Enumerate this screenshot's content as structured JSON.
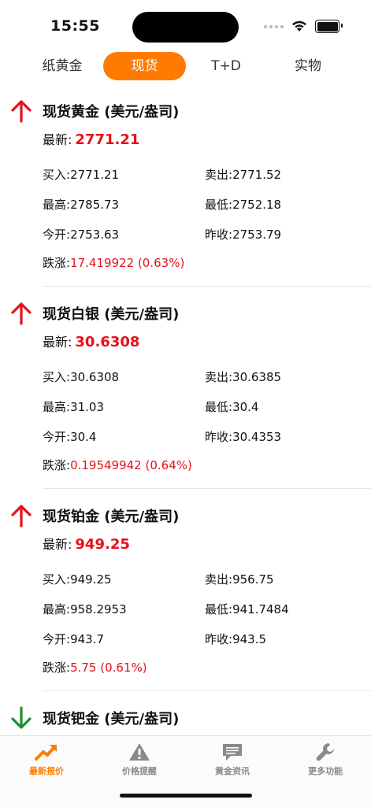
{
  "status": {
    "time": "15:55"
  },
  "tabs": [
    {
      "label": "纸黄金"
    },
    {
      "label": "现货"
    },
    {
      "label": "T+D"
    },
    {
      "label": "实物"
    }
  ],
  "items": [
    {
      "direction": "up",
      "title": "现货黄金 (美元/盎司)",
      "latest_label": "最新:",
      "latest": "2771.21",
      "buy_label": "买入:",
      "buy": "2771.21",
      "sell_label": "卖出:",
      "sell": "2771.52",
      "high_label": "最高:",
      "high": "2785.73",
      "low_label": "最低:",
      "low": "2752.18",
      "open_label": "今开:",
      "open": "2753.63",
      "close_label": "昨收:",
      "close": "2753.79",
      "change_label": "跌涨:",
      "change": "17.419922 (0.63%)"
    },
    {
      "direction": "up",
      "title": "现货白银 (美元/盎司)",
      "latest_label": "最新:",
      "latest": "30.6308",
      "buy_label": "买入:",
      "buy": "30.6308",
      "sell_label": "卖出:",
      "sell": "30.6385",
      "high_label": "最高:",
      "high": "31.03",
      "low_label": "最低:",
      "low": "30.4",
      "open_label": "今开:",
      "open": "30.4",
      "close_label": "昨收:",
      "close": "30.4353",
      "change_label": "跌涨:",
      "change": "0.19549942 (0.64%)"
    },
    {
      "direction": "up",
      "title": "现货铂金 (美元/盎司)",
      "latest_label": "最新:",
      "latest": "949.25",
      "buy_label": "买入:",
      "buy": "949.25",
      "sell_label": "卖出:",
      "sell": "956.75",
      "high_label": "最高:",
      "high": "958.2953",
      "low_label": "最低:",
      "low": "941.7484",
      "open_label": "今开:",
      "open": "943.7",
      "close_label": "昨收:",
      "close": "943.5",
      "change_label": "跌涨:",
      "change": "5.75 (0.61%)"
    },
    {
      "direction": "down",
      "title": "现货钯金 (美元/盎司)"
    }
  ],
  "nav": [
    {
      "label": "最新报价",
      "icon": "trend-up-icon"
    },
    {
      "label": "价格提醒",
      "icon": "warning-icon"
    },
    {
      "label": "黄金资讯",
      "icon": "message-icon"
    },
    {
      "label": "更多功能",
      "icon": "wrench-icon"
    }
  ],
  "colors": {
    "accent": "#ff7a00",
    "up": "#e8101a",
    "down": "#1a8f2e"
  }
}
